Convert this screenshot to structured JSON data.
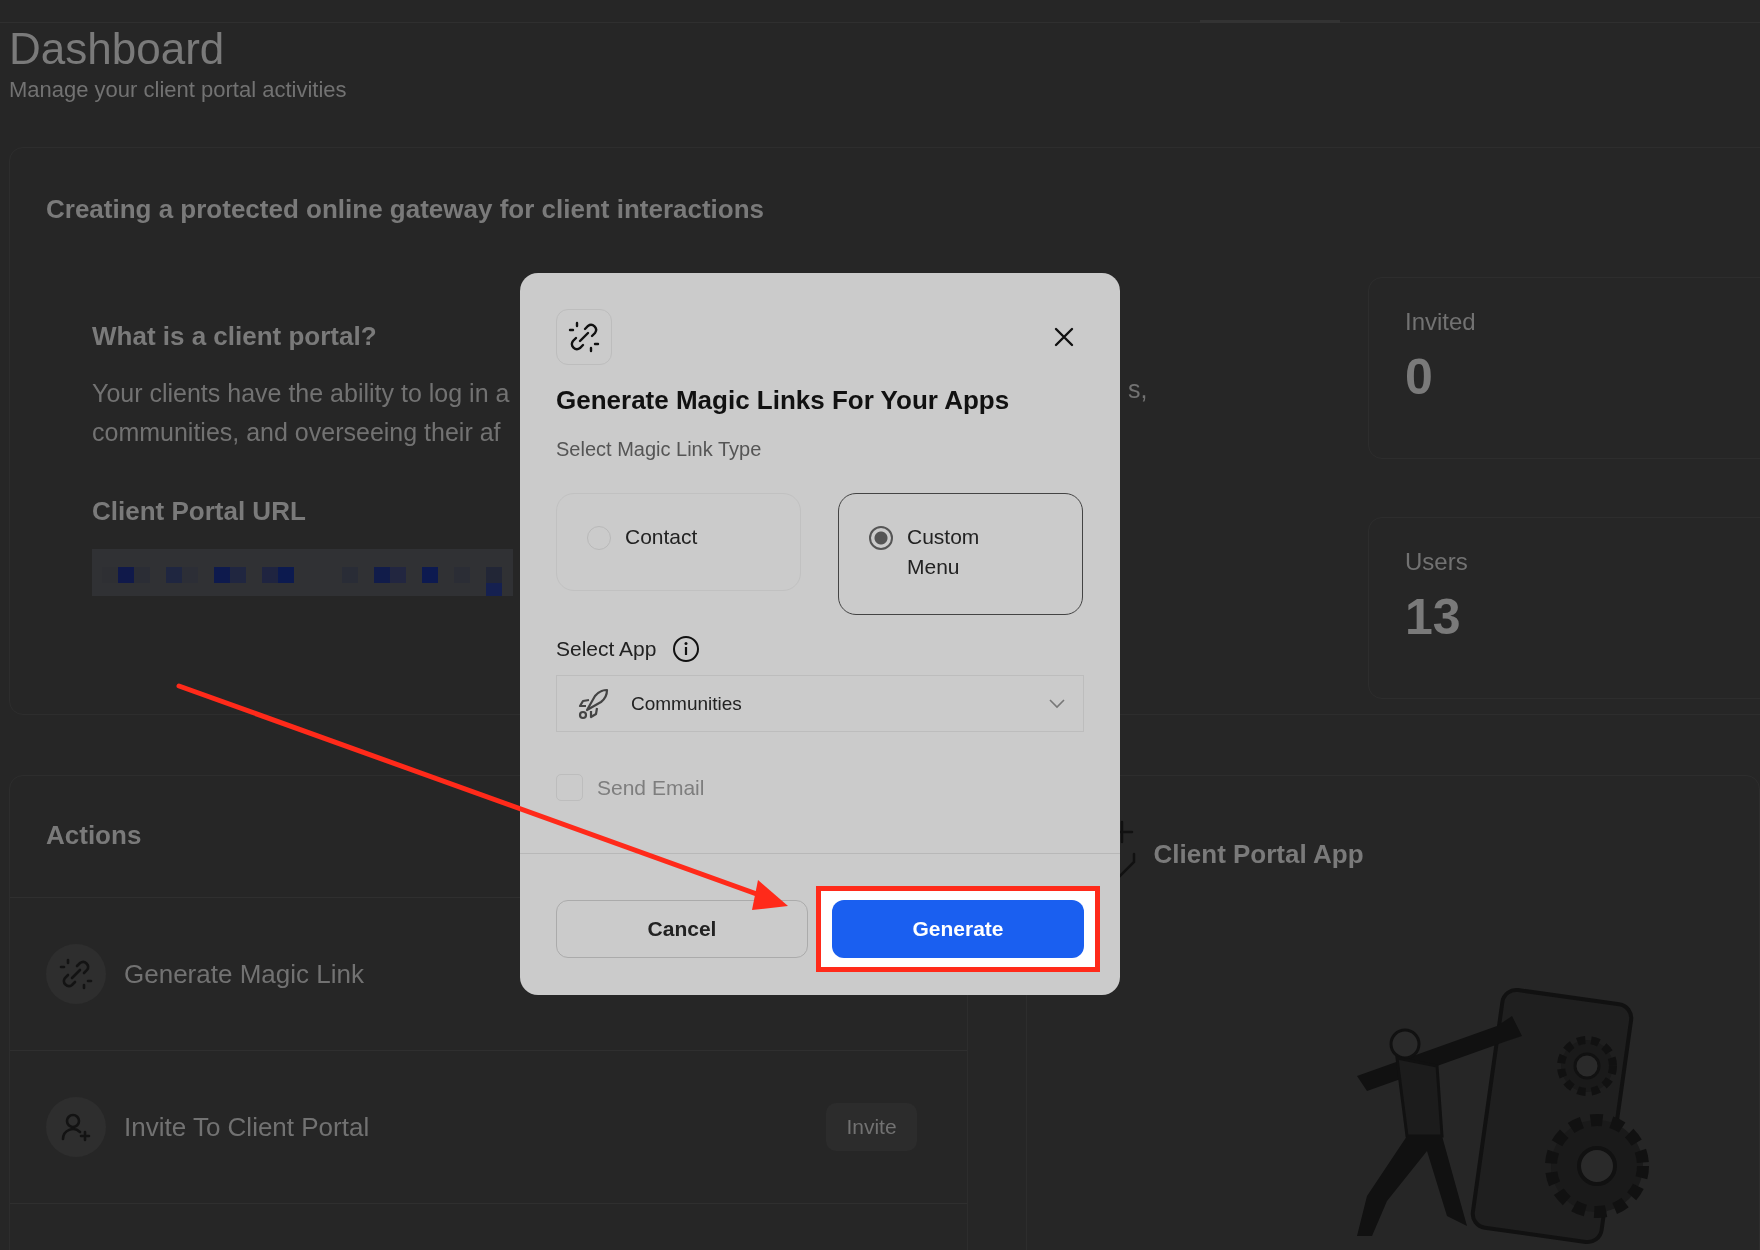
{
  "header": {
    "title": "Dashboard",
    "subtitle": "Manage your client portal activities"
  },
  "intro": {
    "heading": "Creating a protected online gateway for client interactions",
    "question": "What is a client portal?",
    "paragraph_lines": [
      "Your clients have the ability to log in a",
      "communities, and overseeing their af"
    ],
    "paragraph_tail": "s,",
    "url_label": "Client Portal URL"
  },
  "stats": [
    {
      "label": "Invited",
      "value": "0"
    },
    {
      "label": "Users",
      "value": "13"
    }
  ],
  "actions": {
    "title": "Actions",
    "items": [
      {
        "kind": "magic-link",
        "label": "Generate Magic Link"
      },
      {
        "kind": "invite",
        "label": "Invite To Client Portal",
        "button": "Invite"
      }
    ]
  },
  "app_card": {
    "title": "Client Portal App"
  },
  "dialog": {
    "title": "Generate Magic Links For Your Apps",
    "type_label": "Select Magic Link Type",
    "link_types": [
      {
        "label": "Contact",
        "selected": false
      },
      {
        "label": "Custom Menu",
        "selected": true
      }
    ],
    "app_label": "Select App",
    "app_select": {
      "value": "Communities"
    },
    "send_email": {
      "label": "Send Email",
      "checked": false,
      "disabled": true
    },
    "buttons": [
      {
        "kind": "secondary",
        "label": "Cancel"
      },
      {
        "kind": "primary",
        "label": "Generate",
        "highlighted": true
      }
    ]
  }
}
